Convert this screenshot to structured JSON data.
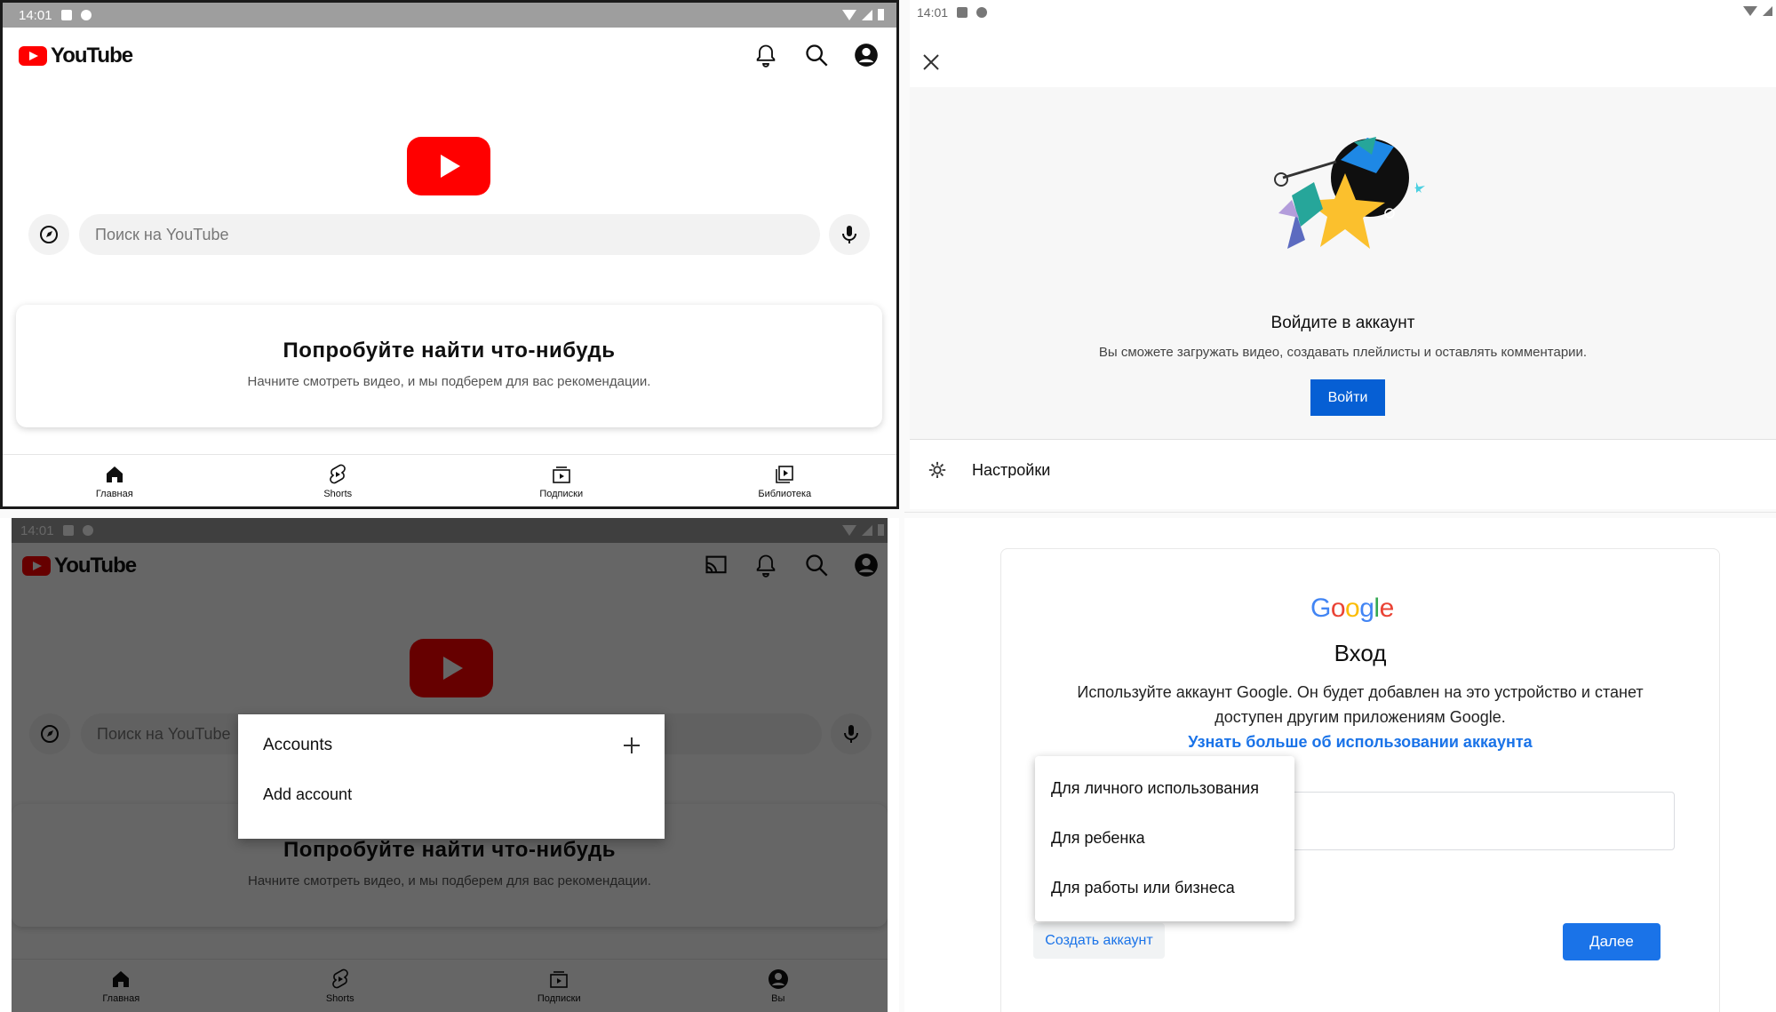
{
  "status": {
    "time": "14:01"
  },
  "youtube": {
    "logo_text": "YouTube",
    "search_placeholder": "Поиск на YouTube",
    "empty_title": "Попробуйте найти что-нибудь",
    "empty_subtitle": "Начните смотреть видео, и мы подберем для вас рекомендации.",
    "nav": [
      {
        "label": "Главная",
        "icon": "home-icon"
      },
      {
        "label": "Shorts",
        "icon": "shorts-icon"
      },
      {
        "label": "Подписки",
        "icon": "subscriptions-icon"
      },
      {
        "label": "Библиотека",
        "icon": "library-icon"
      }
    ],
    "nav_bottom_last": "Вы"
  },
  "signin": {
    "title": "Войдите в аккаунт",
    "subtitle": "Вы сможете загружать видео, создавать плейлисты и оставлять комментарии.",
    "button": "Войти",
    "settings": "Настройки"
  },
  "accounts_popup": {
    "title": "Accounts",
    "add_account": "Add account"
  },
  "google": {
    "logo": [
      "G",
      "o",
      "o",
      "g",
      "l",
      "e"
    ],
    "logo_colors": [
      "#4285F4",
      "#EA4335",
      "#FBBC05",
      "#4285F4",
      "#34A853",
      "#EA4335"
    ],
    "heading": "Вход",
    "text_line1": "Используйте аккаунт Google. Он будет добавлен на это устройство и станет",
    "text_line2": "доступен другим приложениям Google.",
    "learn_more": "Узнать больше об использовании аккаунта",
    "menu": [
      "Для личного использования",
      "Для ребенка",
      "Для работы или бизнеса"
    ],
    "create_account": "Создать аккаунт",
    "next": "Далее"
  },
  "colors": {
    "accent": "#1a73e8",
    "youtube_red": "#ff0000",
    "signin_button": "#065fd4"
  }
}
